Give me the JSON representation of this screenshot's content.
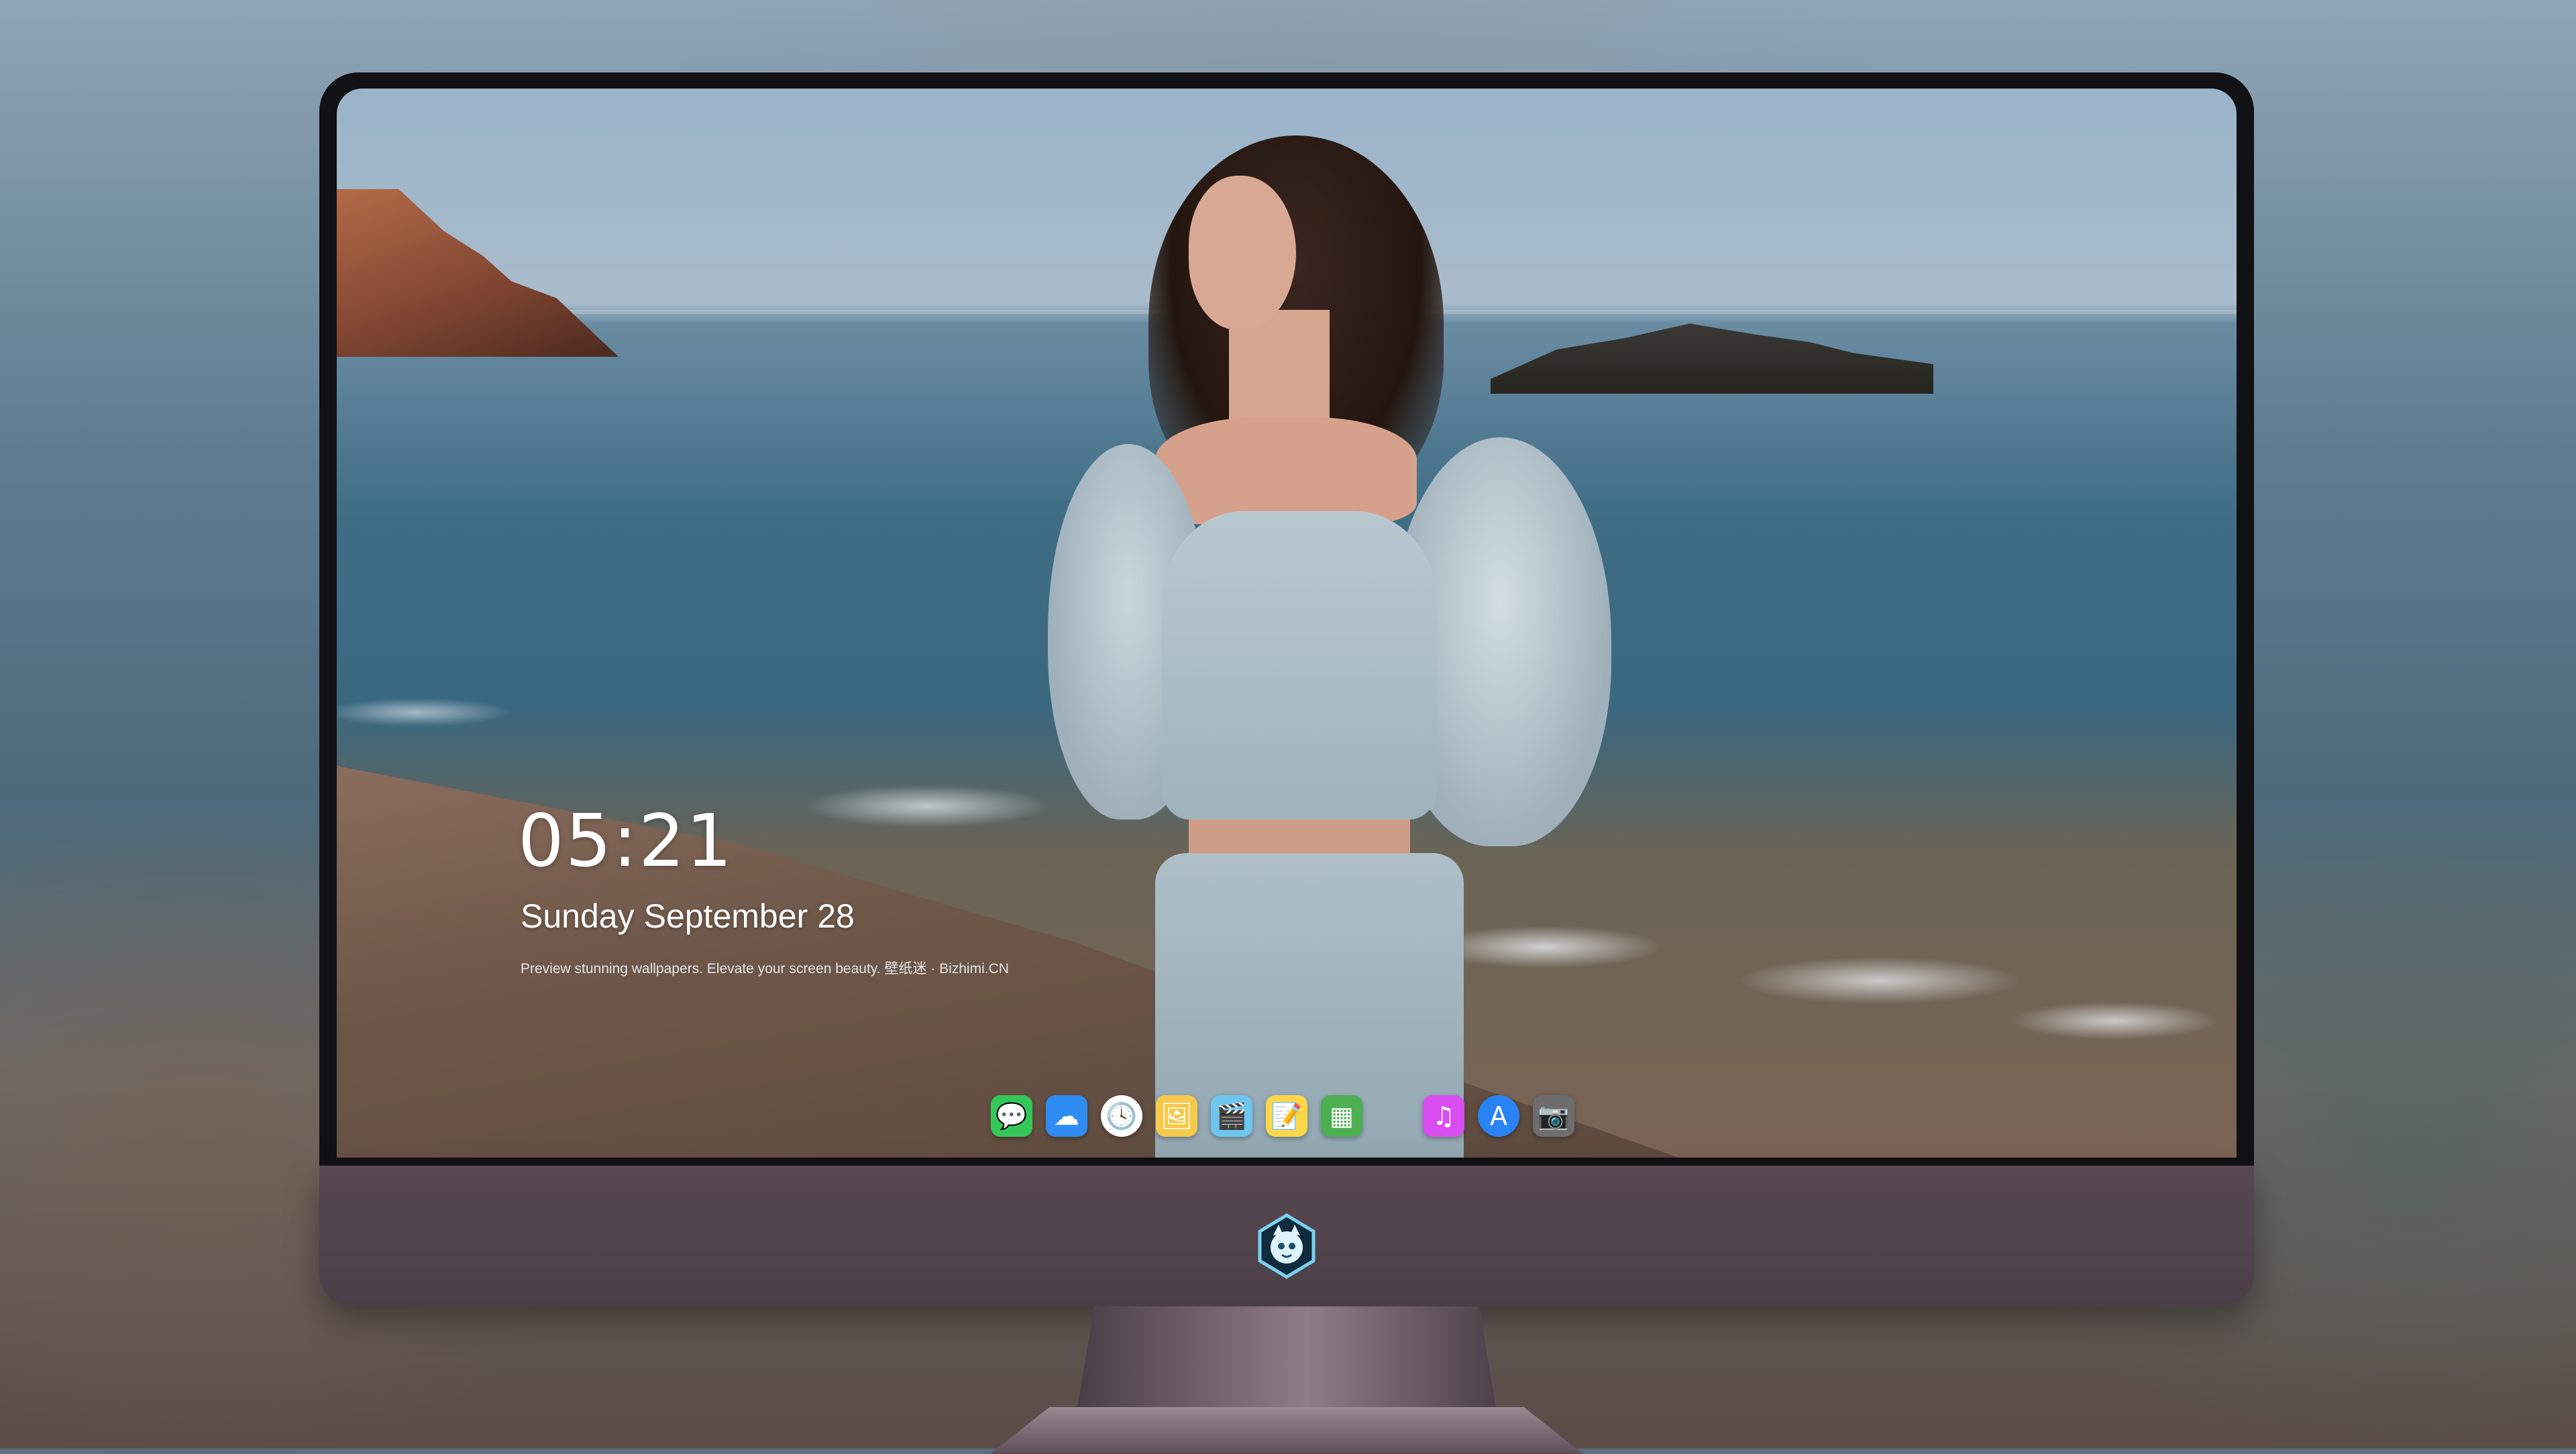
{
  "lockscreen": {
    "time": "05:21",
    "day": "Sunday",
    "month": "September",
    "date": "28",
    "tagline": "Preview stunning wallpapers. Elevate your screen beauty. 壁纸迷 · Bizhimi.CN"
  },
  "dock": {
    "apps": [
      {
        "name": "messages",
        "icon": "chat-bubble-icon",
        "glyph": "💬",
        "color": "#34c759"
      },
      {
        "name": "weather",
        "icon": "cloud-icon",
        "glyph": "☁",
        "color": "#2f8cf2"
      },
      {
        "name": "clock",
        "icon": "clock-icon",
        "glyph": "🕓",
        "color": "#ffffff"
      },
      {
        "name": "preview",
        "icon": "preview-icon",
        "glyph": "🖼",
        "color": "#f5c94a"
      },
      {
        "name": "video-editor",
        "icon": "clapperboard-icon",
        "glyph": "🎬",
        "color": "#6ec6f0"
      },
      {
        "name": "notes",
        "icon": "notes-icon",
        "glyph": "📝",
        "color": "#ffd84a"
      },
      {
        "name": "photo-booth",
        "icon": "photo-grid-icon",
        "glyph": "▦",
        "color": "#4caf50"
      },
      {
        "name": "music",
        "icon": "music-note-icon",
        "glyph": "♫",
        "color": "#d84ef0"
      },
      {
        "name": "app-store",
        "icon": "app-store-icon",
        "glyph": "A",
        "color": "#2a83f5"
      },
      {
        "name": "camera",
        "icon": "camera-icon",
        "glyph": "📷",
        "color": "#6d6d6d"
      }
    ]
  },
  "colors": {
    "chin": "#574850",
    "bezel": "#121113"
  }
}
